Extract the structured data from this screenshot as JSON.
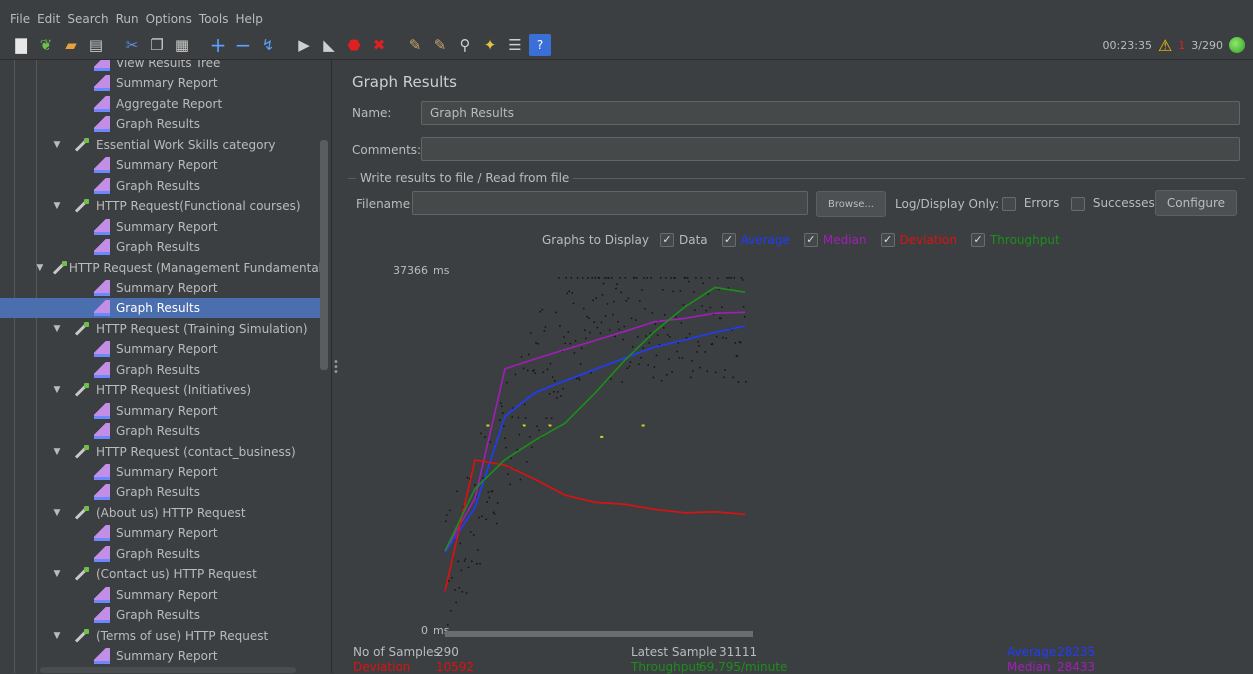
{
  "menu": [
    "File",
    "Edit",
    "Search",
    "Run",
    "Options",
    "Tools",
    "Help"
  ],
  "toolbar": {
    "elapsed": "00:23:35",
    "error_count": "1",
    "threads": "3/290"
  },
  "tree": {
    "items": [
      {
        "label": "View Results Tree",
        "type": "report",
        "indent": 2,
        "selected": false
      },
      {
        "label": "Summary Report",
        "type": "report",
        "indent": 2,
        "selected": false
      },
      {
        "label": "Aggregate Report",
        "type": "report",
        "indent": 2,
        "selected": false
      },
      {
        "label": "Graph Results",
        "type": "report",
        "indent": 2,
        "selected": false
      },
      {
        "label": "Essential Work Skills category",
        "type": "sampler",
        "indent": 1,
        "selected": false
      },
      {
        "label": "Summary Report",
        "type": "report",
        "indent": 2,
        "selected": false
      },
      {
        "label": "Graph Results",
        "type": "report",
        "indent": 2,
        "selected": false
      },
      {
        "label": "HTTP Request(Functional courses)",
        "type": "sampler",
        "indent": 1,
        "selected": false
      },
      {
        "label": "Summary Report",
        "type": "report",
        "indent": 2,
        "selected": false
      },
      {
        "label": "Graph Results",
        "type": "report",
        "indent": 2,
        "selected": false
      },
      {
        "label": "HTTP Request (Management Fundamental",
        "type": "sampler",
        "indent": 1,
        "selected": false
      },
      {
        "label": "Summary Report",
        "type": "report",
        "indent": 2,
        "selected": false
      },
      {
        "label": "Graph Results",
        "type": "report",
        "indent": 2,
        "selected": true
      },
      {
        "label": "HTTP Request (Training Simulation)",
        "type": "sampler",
        "indent": 1,
        "selected": false
      },
      {
        "label": "Summary Report",
        "type": "report",
        "indent": 2,
        "selected": false
      },
      {
        "label": "Graph Results",
        "type": "report",
        "indent": 2,
        "selected": false
      },
      {
        "label": "HTTP Request (Initiatives)",
        "type": "sampler",
        "indent": 1,
        "selected": false
      },
      {
        "label": "Summary Report",
        "type": "report",
        "indent": 2,
        "selected": false
      },
      {
        "label": "Graph Results",
        "type": "report",
        "indent": 2,
        "selected": false
      },
      {
        "label": "HTTP Request (contact_business)",
        "type": "sampler",
        "indent": 1,
        "selected": false
      },
      {
        "label": "Summary Report",
        "type": "report",
        "indent": 2,
        "selected": false
      },
      {
        "label": "Graph Results",
        "type": "report",
        "indent": 2,
        "selected": false
      },
      {
        "label": "(About us) HTTP Request",
        "type": "sampler",
        "indent": 1,
        "selected": false
      },
      {
        "label": "Summary Report",
        "type": "report",
        "indent": 2,
        "selected": false
      },
      {
        "label": "Graph Results",
        "type": "report",
        "indent": 2,
        "selected": false
      },
      {
        "label": "(Contact us) HTTP Request",
        "type": "sampler",
        "indent": 1,
        "selected": false
      },
      {
        "label": "Summary Report",
        "type": "report",
        "indent": 2,
        "selected": false
      },
      {
        "label": "Graph Results",
        "type": "report",
        "indent": 2,
        "selected": false
      },
      {
        "label": "(Terms of use) HTTP Request",
        "type": "sampler",
        "indent": 1,
        "selected": false
      },
      {
        "label": "Summary Report",
        "type": "report",
        "indent": 2,
        "selected": false
      }
    ]
  },
  "panel": {
    "title": "Graph Results",
    "name_label": "Name:",
    "name_value": "Graph Results",
    "comments_label": "Comments:",
    "comments_value": "",
    "file_group_title": "Write results to file / Read from file",
    "filename_label": "Filename",
    "filename_value": "",
    "browse_label": "Browse...",
    "log_display_label": "Log/Display Only:",
    "errors_label": "Errors",
    "successes_label": "Successes",
    "configure_label": "Configure"
  },
  "graphs_to_display": {
    "label": "Graphs to Display",
    "options": [
      {
        "label": "Data",
        "checked": true,
        "color": "#bbbbbb"
      },
      {
        "label": "Average",
        "checked": true,
        "color": "#1f3cff"
      },
      {
        "label": "Median",
        "checked": true,
        "color": "#a01fb8"
      },
      {
        "label": "Deviation",
        "checked": true,
        "color": "#e01010"
      },
      {
        "label": "Throughput",
        "checked": true,
        "color": "#1a8f1a"
      }
    ]
  },
  "colors": {
    "data": "#111111",
    "average": "#1f3cff",
    "median": "#a01fb8",
    "deviation": "#e01010",
    "throughput": "#1a8f1a",
    "outlier": "#d8d020"
  },
  "chart_data": {
    "type": "line",
    "y_max_label": "37366",
    "y_min_label": "0",
    "y_unit": "ms",
    "ylim": [
      0,
      37366
    ],
    "x": [
      0,
      29,
      58,
      87,
      116,
      145,
      174,
      203,
      232,
      261,
      290
    ],
    "series": [
      {
        "name": "Average",
        "key": "average",
        "values": [
          7800,
          12500,
          22000,
          24500,
          25800,
          27000,
          28200,
          29300,
          30000,
          30800,
          31500
        ]
      },
      {
        "name": "Median",
        "key": "median",
        "values": [
          8000,
          13500,
          27000,
          28000,
          29000,
          30000,
          31000,
          32000,
          32300,
          32800,
          32900
        ]
      },
      {
        "name": "Deviation",
        "key": "deviation",
        "values": [
          3700,
          17500,
          17000,
          15500,
          13800,
          13000,
          12800,
          12300,
          12000,
          12100,
          11800
        ]
      },
      {
        "name": "Throughput",
        "key": "throughput",
        "values": [
          8000,
          14500,
          17500,
          19500,
          21300,
          24500,
          28000,
          31000,
          33500,
          35500,
          35000
        ]
      }
    ]
  },
  "stats": {
    "samples_label": "No of Samples",
    "samples_value": "290",
    "latest_label": "Latest Sample",
    "latest_value": "31111",
    "average_label": "Average",
    "average_value": "28235",
    "deviation_label": "Deviation",
    "deviation_value": "10592",
    "throughput_label": "Throughput",
    "throughput_value": "69.795/minute",
    "median_label": "Median",
    "median_value": "28433"
  }
}
